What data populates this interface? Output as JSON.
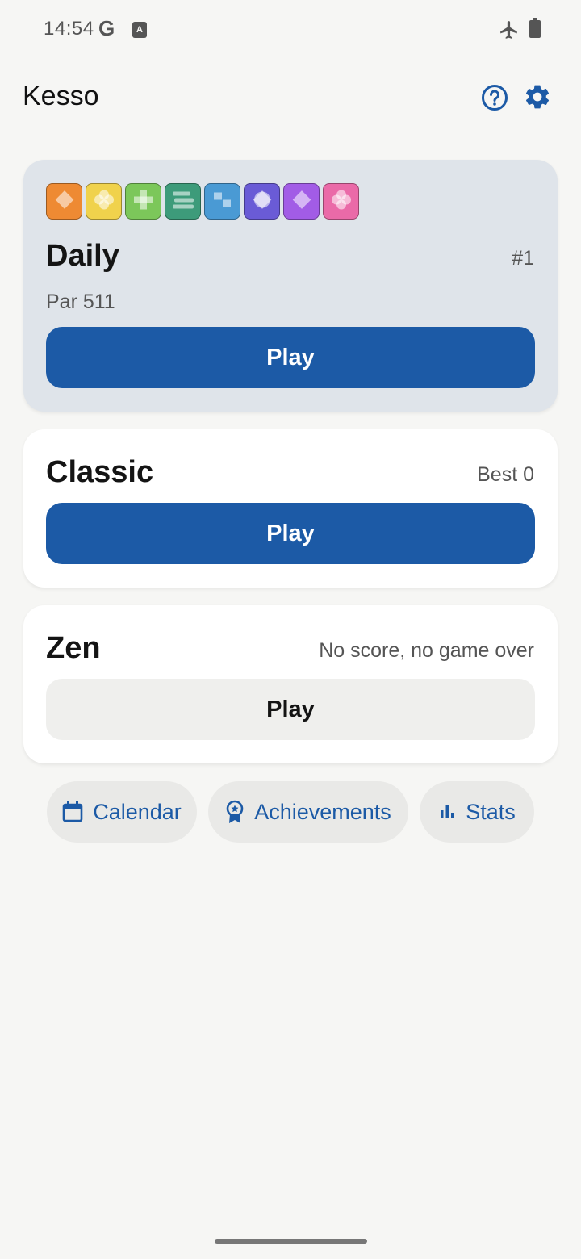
{
  "status_bar": {
    "time": "14:54",
    "google_glyph": "G",
    "notif_glyph": "A",
    "icons": [
      "airplane-icon",
      "battery-icon"
    ]
  },
  "app_bar": {
    "title": "Kesso",
    "icons": [
      "help-icon",
      "settings-icon"
    ],
    "accent": "#1c5aa6"
  },
  "daily": {
    "title": "Daily",
    "number": "#1",
    "par": "Par 511",
    "play_label": "Play",
    "tiles": [
      {
        "color": "#ee8a33",
        "symbol": "diamond"
      },
      {
        "color": "#f0d24c",
        "symbol": "flower"
      },
      {
        "color": "#7cc75a",
        "symbol": "plus"
      },
      {
        "color": "#3d9b7a",
        "symbol": "lines"
      },
      {
        "color": "#4a9ad4",
        "symbol": "squares"
      },
      {
        "color": "#6a5bd6",
        "symbol": "star"
      },
      {
        "color": "#a25ce6",
        "symbol": "diamond"
      },
      {
        "color": "#ea6aa8",
        "symbol": "flower"
      }
    ]
  },
  "classic": {
    "title": "Classic",
    "best": "Best 0",
    "play_label": "Play"
  },
  "zen": {
    "title": "Zen",
    "subtitle": "No score, no game over",
    "play_label": "Play"
  },
  "chips": {
    "calendar": "Calendar",
    "achievements": "Achievements",
    "stats": "Stats"
  },
  "colors": {
    "primary": "#1c5aa6",
    "background": "#f6f6f4",
    "daily_card": "#dfe4ea"
  }
}
